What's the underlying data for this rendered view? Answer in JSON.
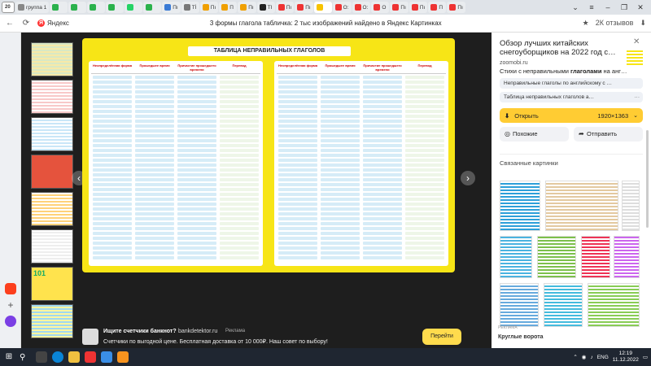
{
  "tabs": {
    "badge_label": "20",
    "items": [
      {
        "label": "группа 1",
        "icon": "page-icon",
        "color": "#888"
      },
      {
        "label": "",
        "icon": "plus-icon",
        "color": "#2bb24c"
      },
      {
        "label": "",
        "icon": "plus-icon",
        "color": "#2bb24c"
      },
      {
        "label": "",
        "icon": "plus-icon",
        "color": "#2bb24c"
      },
      {
        "label": "",
        "icon": "plus-icon",
        "color": "#2bb24c"
      },
      {
        "label": "",
        "icon": "whatsapp-icon",
        "color": "#25d366"
      },
      {
        "label": "",
        "icon": "plus-icon",
        "color": "#2bb24c"
      },
      {
        "label": "Пı",
        "icon": "mail-icon",
        "color": "#3a7bd5"
      },
      {
        "label": "Тİ",
        "icon": "page-icon",
        "color": "#777"
      },
      {
        "label": "Пı",
        "icon": "page-icon",
        "color": "#f0a000"
      },
      {
        "label": "П",
        "icon": "page-icon",
        "color": "#f0a000"
      },
      {
        "label": "Пı",
        "icon": "page-icon",
        "color": "#f0a000"
      },
      {
        "label": "ТІ",
        "icon": "page-icon",
        "color": "#222"
      },
      {
        "label": "Пı",
        "icon": "page-icon",
        "color": "#e33"
      },
      {
        "label": "Пı",
        "icon": "page-icon",
        "color": "#e33"
      },
      {
        "label": "",
        "icon": "yandex-images-icon",
        "color": "#f7c300"
      },
      {
        "label": "О:",
        "icon": "page-icon",
        "color": "#e33"
      },
      {
        "label": "О:",
        "icon": "page-icon",
        "color": "#e33"
      },
      {
        "label": "О",
        "icon": "page-icon",
        "color": "#e33"
      },
      {
        "label": "Пı",
        "icon": "page-icon",
        "color": "#e33"
      },
      {
        "label": "Пı",
        "icon": "page-icon",
        "color": "#e33"
      },
      {
        "label": "П",
        "icon": "page-icon",
        "color": "#e33"
      },
      {
        "label": "Пı",
        "icon": "page-icon",
        "color": "#e33"
      }
    ]
  },
  "addressbar": {
    "logo_text": "Яндекс",
    "page_title": "3 формы глагола табличка: 2 тыс изображений найдено в Яндекс Картинках",
    "bookmark_count": "2К отзывов"
  },
  "viewer": {
    "image_heading": "ТАБЛИЦА НЕПРАВИЛЬНЫХ ГЛАГОЛОВ",
    "thumb7_text": "101",
    "table_headers": [
      "Неопределённая форма",
      "Прошедшее время",
      "Причастие прошедшего времени",
      "Перевод"
    ],
    "ad": {
      "title": "Ищите счетчики банкнот?",
      "domain": "bankdetektor.ru",
      "tag": "Реклама",
      "text": "Счетчики по выгодной цене. Бесплатная доставка от 10 000₽. Наш совет по выбору!",
      "button": "Перейти"
    }
  },
  "info": {
    "title": "Обзор лучших китайских снегоуборщиков на 2022 год с…",
    "domain": "zoomobi.ru",
    "desc_prefix": "Стихи с неправильными ",
    "desc_bold": "глаголами",
    "desc_suffix": " на анг…",
    "chips": [
      "Неправильные глаголы по английскому с …",
      "Таблица неправильных глаголов а…"
    ],
    "open_label": "Открыть",
    "size": "1920×1363",
    "similar_label": "Похожие",
    "share_label": "Отправить",
    "related_title": "Связанные картинки",
    "reklama": "РЕКЛАМА",
    "reklama_text": "Круглые ворота"
  },
  "taskbar": {
    "lang": "ENG",
    "time": "12:19",
    "date": "11.12.2022"
  }
}
